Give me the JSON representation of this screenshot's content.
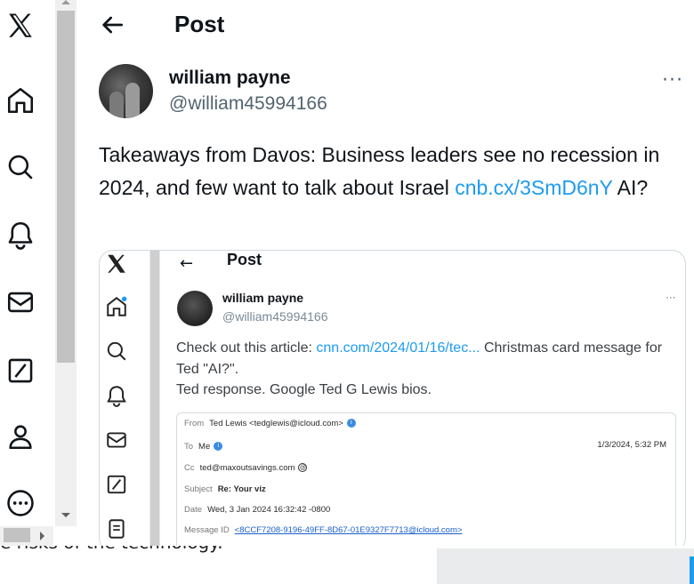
{
  "header": {
    "title": "Post"
  },
  "nav": {
    "items": [
      "x-logo-icon",
      "home-icon",
      "search-icon",
      "notifications-icon",
      "messages-icon",
      "grok-icon",
      "profile-icon",
      "more-icon"
    ]
  },
  "post": {
    "author_name": "william payne",
    "author_handle": "@william45994166",
    "more": "···",
    "text_before": "Takeaways from Davos: Business leaders see no recession in 2024, and few want to talk about Israel ",
    "link": "cnb.cx/3SmD6nY",
    "text_after": " AI?"
  },
  "embedded": {
    "header_title": "Post",
    "author_name": "william payne",
    "author_handle": "@william45994166",
    "text_before": "Check out this article: ",
    "link": "cnn.com/2024/01/16/tec...",
    "text_after": " Christmas card message for Ted \"AI?\".",
    "text_line2": "Ted response.  Google Ted G Lewis bios.",
    "email": {
      "from_key": "From",
      "from_val": "Ted Lewis <tedglewis@icloud.com>",
      "to_key": "To",
      "to_val": "Me",
      "date_right": "1/3/2024, 5:32 PM",
      "cc_key": "Cc",
      "cc_val": "ted@maxoutsavings.com",
      "subject_key": "Subject",
      "subject_val": "Re: Your viz",
      "date_key": "Date",
      "date_val": "Wed, 3 Jan 2024 16:32:42 -0800",
      "msgid_key": "Message ID",
      "msgid_val": "<8CCF7208-9196-49FF-8D67-01E9327F7713@icloud.com>"
    }
  },
  "bottom": {
    "text": "e risks of the technology."
  },
  "colors": {
    "link": "#1d9bf0",
    "secondary": "#536471",
    "text": "#0f1419"
  }
}
